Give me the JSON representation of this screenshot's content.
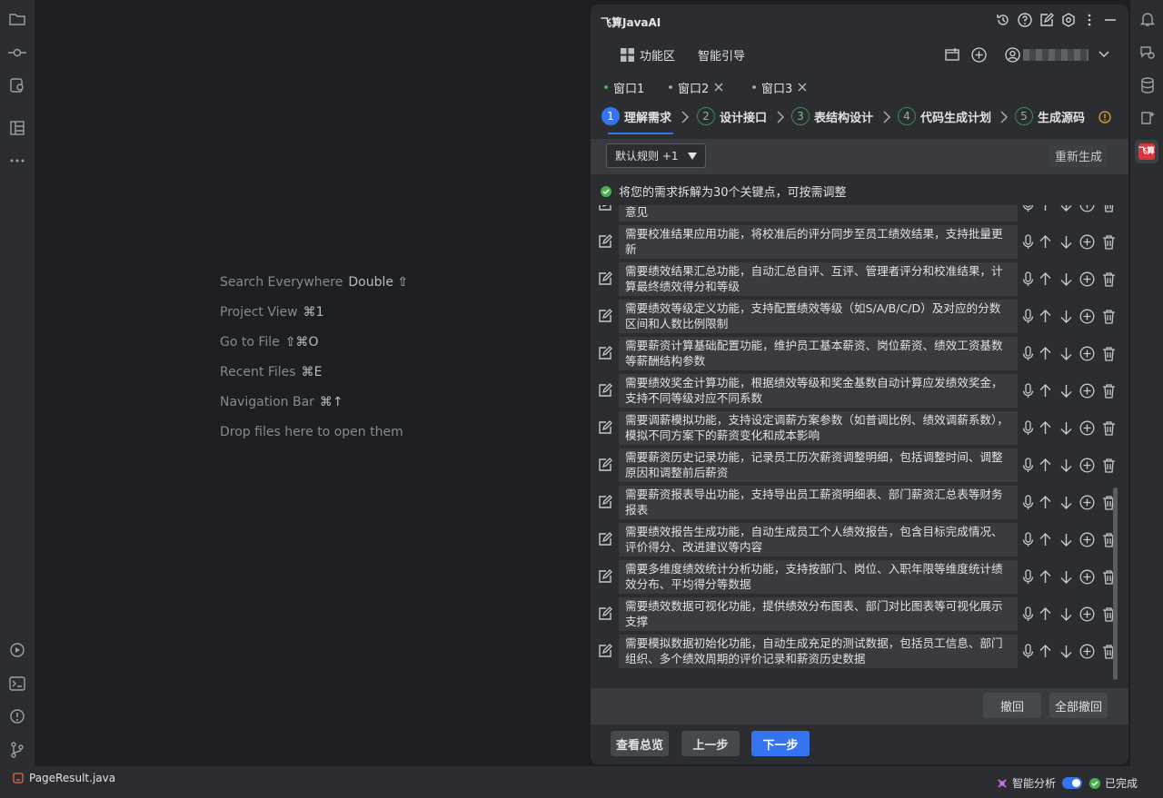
{
  "left_toolbar": {
    "icons": [
      "folder-icon",
      "commit-icon",
      "pull-requests-icon",
      "structure-icon",
      "more-icon",
      "run-icon",
      "terminal-icon",
      "problems-icon",
      "git-icon"
    ]
  },
  "right_toolbar": {
    "icons": [
      "notifications-icon",
      "ai-chat-icon",
      "database-icon",
      "ai-assistant-icon",
      "feisuan-icon"
    ],
    "feisuan_label": "飞算"
  },
  "editor": {
    "hints": [
      {
        "label": "Search Everywhere",
        "key": "Double ⇧"
      },
      {
        "label": "Project View",
        "key": "⌘1"
      },
      {
        "label": "Go to File",
        "key": "⇧⌘O"
      },
      {
        "label": "Recent Files",
        "key": "⌘E"
      },
      {
        "label": "Navigation Bar",
        "key": "⌘↑"
      },
      {
        "label": "Drop files here to open them",
        "key": ""
      }
    ]
  },
  "panel": {
    "title": "飞算JavaAI",
    "nav": {
      "function_area": "功能区",
      "smart_guide": "智能引导"
    },
    "user_name": "",
    "tabs": [
      {
        "label": "窗口1",
        "active": true
      },
      {
        "label": "窗口2",
        "active": false
      },
      {
        "label": "窗口3",
        "active": false
      }
    ],
    "steps": [
      {
        "num": "1",
        "label": "理解需求",
        "current": true
      },
      {
        "num": "2",
        "label": "设计接口",
        "current": false
      },
      {
        "num": "3",
        "label": "表结构设计",
        "current": false
      },
      {
        "num": "4",
        "label": "代码生成计划",
        "current": false
      },
      {
        "num": "5",
        "label": "生成源码",
        "current": false
      }
    ],
    "rules_select": "默认规则 +1",
    "regenerate": "重新生成",
    "info": "将您的需求拆解为30个关键点，可按需调整",
    "items": [
      {
        "text": "需要员工绩效评价结果汇总与反馈功能，主管可查看下属的评价并给出反馈意见"
      },
      {
        "text": "需要校准结果应用功能，将校准后的评分同步至员工绩效结果，支持批量更新"
      },
      {
        "text": "需要绩效结果汇总功能，自动汇总自评、互评、管理者评分和校准结果，计算最终绩效得分和等级"
      },
      {
        "text": "需要绩效等级定义功能，支持配置绩效等级（如S/A/B/C/D）及对应的分数区间和人数比例限制"
      },
      {
        "text": "需要薪资计算基础配置功能，维护员工基本薪资、岗位薪资、绩效工资基数等薪酬结构参数"
      },
      {
        "text": "需要绩效奖金计算功能，根据绩效等级和奖金基数自动计算应发绩效奖金，支持不同等级对应不同系数"
      },
      {
        "text": "需要调薪模拟功能，支持设定调薪方案参数（如普调比例、绩效调薪系数），模拟不同方案下的薪资变化和成本影响"
      },
      {
        "text": "需要薪资历史记录功能，记录员工历次薪资调整明细，包括调整时间、调整原因和调整前后薪资"
      },
      {
        "text": "需要薪资报表导出功能，支持导出员工薪资明细表、部门薪资汇总表等财务报表"
      },
      {
        "text": "需要绩效报告生成功能，自动生成员工个人绩效报告，包含目标完成情况、评价得分、改进建议等内容"
      },
      {
        "text": "需要多维度绩效统计分析功能，支持按部门、岗位、入职年限等维度统计绩效分布、平均得分等数据"
      },
      {
        "text": "需要绩效数据可视化功能，提供绩效分布图表、部门对比图表等可视化展示支撑"
      },
      {
        "text": "需要模拟数据初始化功能，自动生成充足的测试数据，包括员工信息、部门组织、多个绩效周期的评价记录和薪资历史数据"
      }
    ],
    "undo": "撤回",
    "undo_all": "全部撤回",
    "view_overview": "查看总览",
    "prev_step": "上一步",
    "next_step": "下一步"
  },
  "status_bar": {
    "file": "PageResult.java",
    "smart_analysis": "智能分析",
    "done": "已完成",
    "toggle_on": true
  },
  "colors": {
    "accent": "#3574f0",
    "success": "#4caf50",
    "panel_bg": "#2b2d30",
    "editor_bg": "#1e1f22",
    "badge_red": "#d9363e"
  }
}
